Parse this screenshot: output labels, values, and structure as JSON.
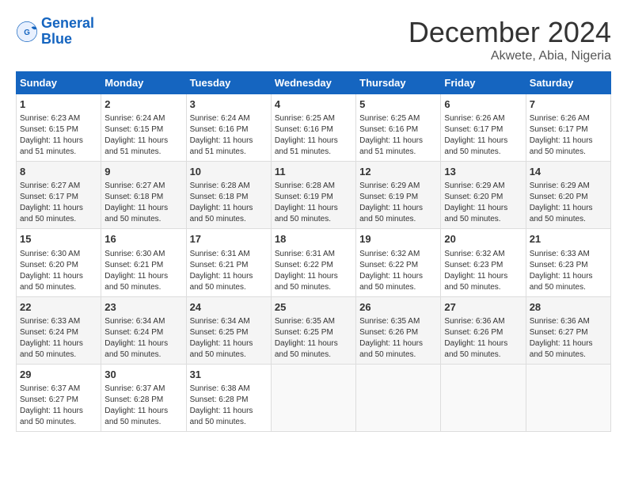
{
  "header": {
    "logo_line1": "General",
    "logo_line2": "Blue",
    "month_title": "December 2024",
    "location": "Akwete, Abia, Nigeria"
  },
  "days_of_week": [
    "Sunday",
    "Monday",
    "Tuesday",
    "Wednesday",
    "Thursday",
    "Friday",
    "Saturday"
  ],
  "weeks": [
    [
      {
        "day": "1",
        "info": "Sunrise: 6:23 AM\nSunset: 6:15 PM\nDaylight: 11 hours and 51 minutes."
      },
      {
        "day": "2",
        "info": "Sunrise: 6:24 AM\nSunset: 6:15 PM\nDaylight: 11 hours and 51 minutes."
      },
      {
        "day": "3",
        "info": "Sunrise: 6:24 AM\nSunset: 6:16 PM\nDaylight: 11 hours and 51 minutes."
      },
      {
        "day": "4",
        "info": "Sunrise: 6:25 AM\nSunset: 6:16 PM\nDaylight: 11 hours and 51 minutes."
      },
      {
        "day": "5",
        "info": "Sunrise: 6:25 AM\nSunset: 6:16 PM\nDaylight: 11 hours and 51 minutes."
      },
      {
        "day": "6",
        "info": "Sunrise: 6:26 AM\nSunset: 6:17 PM\nDaylight: 11 hours and 50 minutes."
      },
      {
        "day": "7",
        "info": "Sunrise: 6:26 AM\nSunset: 6:17 PM\nDaylight: 11 hours and 50 minutes."
      }
    ],
    [
      {
        "day": "8",
        "info": "Sunrise: 6:27 AM\nSunset: 6:17 PM\nDaylight: 11 hours and 50 minutes."
      },
      {
        "day": "9",
        "info": "Sunrise: 6:27 AM\nSunset: 6:18 PM\nDaylight: 11 hours and 50 minutes."
      },
      {
        "day": "10",
        "info": "Sunrise: 6:28 AM\nSunset: 6:18 PM\nDaylight: 11 hours and 50 minutes."
      },
      {
        "day": "11",
        "info": "Sunrise: 6:28 AM\nSunset: 6:19 PM\nDaylight: 11 hours and 50 minutes."
      },
      {
        "day": "12",
        "info": "Sunrise: 6:29 AM\nSunset: 6:19 PM\nDaylight: 11 hours and 50 minutes."
      },
      {
        "day": "13",
        "info": "Sunrise: 6:29 AM\nSunset: 6:20 PM\nDaylight: 11 hours and 50 minutes."
      },
      {
        "day": "14",
        "info": "Sunrise: 6:29 AM\nSunset: 6:20 PM\nDaylight: 11 hours and 50 minutes."
      }
    ],
    [
      {
        "day": "15",
        "info": "Sunrise: 6:30 AM\nSunset: 6:20 PM\nDaylight: 11 hours and 50 minutes."
      },
      {
        "day": "16",
        "info": "Sunrise: 6:30 AM\nSunset: 6:21 PM\nDaylight: 11 hours and 50 minutes."
      },
      {
        "day": "17",
        "info": "Sunrise: 6:31 AM\nSunset: 6:21 PM\nDaylight: 11 hours and 50 minutes."
      },
      {
        "day": "18",
        "info": "Sunrise: 6:31 AM\nSunset: 6:22 PM\nDaylight: 11 hours and 50 minutes."
      },
      {
        "day": "19",
        "info": "Sunrise: 6:32 AM\nSunset: 6:22 PM\nDaylight: 11 hours and 50 minutes."
      },
      {
        "day": "20",
        "info": "Sunrise: 6:32 AM\nSunset: 6:23 PM\nDaylight: 11 hours and 50 minutes."
      },
      {
        "day": "21",
        "info": "Sunrise: 6:33 AM\nSunset: 6:23 PM\nDaylight: 11 hours and 50 minutes."
      }
    ],
    [
      {
        "day": "22",
        "info": "Sunrise: 6:33 AM\nSunset: 6:24 PM\nDaylight: 11 hours and 50 minutes."
      },
      {
        "day": "23",
        "info": "Sunrise: 6:34 AM\nSunset: 6:24 PM\nDaylight: 11 hours and 50 minutes."
      },
      {
        "day": "24",
        "info": "Sunrise: 6:34 AM\nSunset: 6:25 PM\nDaylight: 11 hours and 50 minutes."
      },
      {
        "day": "25",
        "info": "Sunrise: 6:35 AM\nSunset: 6:25 PM\nDaylight: 11 hours and 50 minutes."
      },
      {
        "day": "26",
        "info": "Sunrise: 6:35 AM\nSunset: 6:26 PM\nDaylight: 11 hours and 50 minutes."
      },
      {
        "day": "27",
        "info": "Sunrise: 6:36 AM\nSunset: 6:26 PM\nDaylight: 11 hours and 50 minutes."
      },
      {
        "day": "28",
        "info": "Sunrise: 6:36 AM\nSunset: 6:27 PM\nDaylight: 11 hours and 50 minutes."
      }
    ],
    [
      {
        "day": "29",
        "info": "Sunrise: 6:37 AM\nSunset: 6:27 PM\nDaylight: 11 hours and 50 minutes."
      },
      {
        "day": "30",
        "info": "Sunrise: 6:37 AM\nSunset: 6:28 PM\nDaylight: 11 hours and 50 minutes."
      },
      {
        "day": "31",
        "info": "Sunrise: 6:38 AM\nSunset: 6:28 PM\nDaylight: 11 hours and 50 minutes."
      },
      {
        "day": "",
        "info": ""
      },
      {
        "day": "",
        "info": ""
      },
      {
        "day": "",
        "info": ""
      },
      {
        "day": "",
        "info": ""
      }
    ]
  ]
}
